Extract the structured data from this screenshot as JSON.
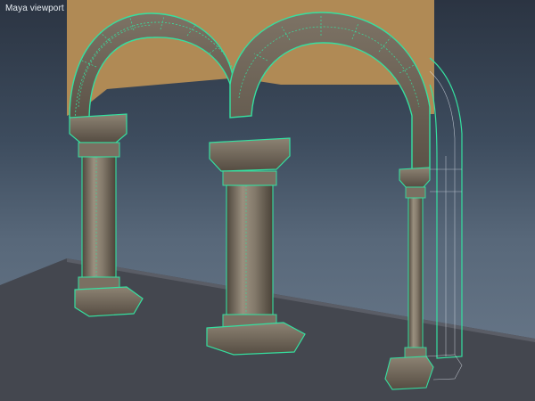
{
  "viewport": {
    "label": "Maya viewport"
  },
  "colors": {
    "background_top": "#2b3442",
    "background_bottom": "#6c7b8c",
    "wall": "#b08a55",
    "ground": "#4a4d55",
    "stone_light": "#8f8576",
    "stone_dark": "#5a5045",
    "wireframe_selection": "#35e0a0"
  },
  "scene": {
    "objects": [
      "wall-plane",
      "ground-plane",
      "arch-left",
      "arch-middle",
      "arch-right-partial",
      "column-left",
      "column-middle",
      "column-right"
    ]
  }
}
